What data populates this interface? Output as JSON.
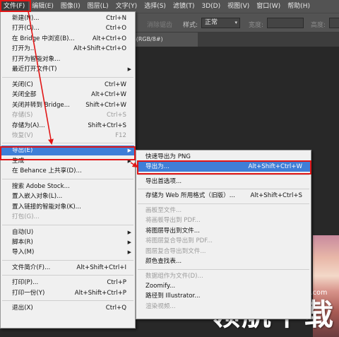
{
  "menubar": [
    "文件(F)",
    "编辑(E)",
    "图像(I)",
    "图层(L)",
    "文字(Y)",
    "选择(S)",
    "滤镜(T)",
    "3D(D)",
    "视图(V)",
    "窗口(W)",
    "帮助(H)"
  ],
  "options_bar": {
    "partial_label": "消除锯齿",
    "style_label": "样式:",
    "style_value": "正常",
    "width_label": "宽度:",
    "height_label": "高度:"
  },
  "document_tab": "0%(RGB/8#)",
  "file_menu": [
    {
      "label": "新建(N)...",
      "shortcut": "Ctrl+N"
    },
    {
      "label": "打开(O)...",
      "shortcut": "Ctrl+O"
    },
    {
      "label": "在 Bridge 中浏览(B)...",
      "shortcut": "Alt+Ctrl+O"
    },
    {
      "label": "打开为...",
      "shortcut": "Alt+Shift+Ctrl+O"
    },
    {
      "label": "打开为智能对象...",
      "shortcut": ""
    },
    {
      "label": "最近打开文件(T)",
      "shortcut": "",
      "submenu": true
    },
    {
      "sep": true
    },
    {
      "label": "关闭(C)",
      "shortcut": "Ctrl+W"
    },
    {
      "label": "关闭全部",
      "shortcut": "Alt+Ctrl+W"
    },
    {
      "label": "关闭并转到 Bridge...",
      "shortcut": "Shift+Ctrl+W"
    },
    {
      "label": "存储(S)",
      "shortcut": "Ctrl+S",
      "disabled": true
    },
    {
      "label": "存储为(A)...",
      "shortcut": "Shift+Ctrl+S"
    },
    {
      "label": "恢复(V)",
      "shortcut": "F12",
      "disabled": true
    },
    {
      "sep": true
    },
    {
      "label": "导出(E)",
      "shortcut": "",
      "submenu": true,
      "highlight": true
    },
    {
      "label": "生成",
      "shortcut": "",
      "submenu": true
    },
    {
      "label": "在 Behance 上共享(D)...",
      "shortcut": ""
    },
    {
      "sep": true
    },
    {
      "label": "搜索 Adobe Stock...",
      "shortcut": ""
    },
    {
      "label": "置入嵌入对象(L)...",
      "shortcut": ""
    },
    {
      "label": "置入链接的智能对象(K)...",
      "shortcut": ""
    },
    {
      "label": "打包(G)...",
      "shortcut": "",
      "disabled": true
    },
    {
      "sep": true
    },
    {
      "label": "自动(U)",
      "shortcut": "",
      "submenu": true
    },
    {
      "label": "脚本(R)",
      "shortcut": "",
      "submenu": true
    },
    {
      "label": "导入(M)",
      "shortcut": "",
      "submenu": true
    },
    {
      "sep": true
    },
    {
      "label": "文件简介(F)...",
      "shortcut": "Alt+Shift+Ctrl+I"
    },
    {
      "sep": true
    },
    {
      "label": "打印(P)...",
      "shortcut": "Ctrl+P"
    },
    {
      "label": "打印一份(Y)",
      "shortcut": "Alt+Shift+Ctrl+P"
    },
    {
      "sep": true
    },
    {
      "label": "退出(X)",
      "shortcut": "Ctrl+Q"
    }
  ],
  "export_menu": [
    {
      "label": "快速导出为 PNG",
      "shortcut": ""
    },
    {
      "label": "导出为...",
      "shortcut": "Alt+Shift+Ctrl+W",
      "highlight": true
    },
    {
      "sep": true
    },
    {
      "label": "导出首选项...",
      "shortcut": ""
    },
    {
      "sep": true
    },
    {
      "label": "存储为 Web 所用格式（旧版）...",
      "shortcut": "Alt+Shift+Ctrl+S"
    },
    {
      "sep": true
    },
    {
      "label": "画板至文件...",
      "shortcut": "",
      "disabled": true
    },
    {
      "label": "将画板导出到 PDF...",
      "shortcut": "",
      "disabled": true
    },
    {
      "label": "将图层导出到文件...",
      "shortcut": ""
    },
    {
      "label": "将图层复合导出到 PDF...",
      "shortcut": "",
      "disabled": true
    },
    {
      "label": "图层复合导出到文件...",
      "shortcut": "",
      "disabled": true
    },
    {
      "label": "颜色查找表...",
      "shortcut": ""
    },
    {
      "sep": true
    },
    {
      "label": "数据组作为文件(D)...",
      "shortcut": "",
      "disabled": true
    },
    {
      "label": "Zoomify...",
      "shortcut": ""
    },
    {
      "label": "路径到 Illustrator...",
      "shortcut": ""
    },
    {
      "label": "渲染视频...",
      "shortcut": "",
      "disabled": true
    }
  ],
  "watermark": {
    "site": "lhdown.com",
    "name": "领航下载"
  },
  "colors": {
    "highlight": "#3f7ed7",
    "annotation_red": "#e11616",
    "menu_bg": "#f0f0f0",
    "app_bg": "#282828"
  }
}
